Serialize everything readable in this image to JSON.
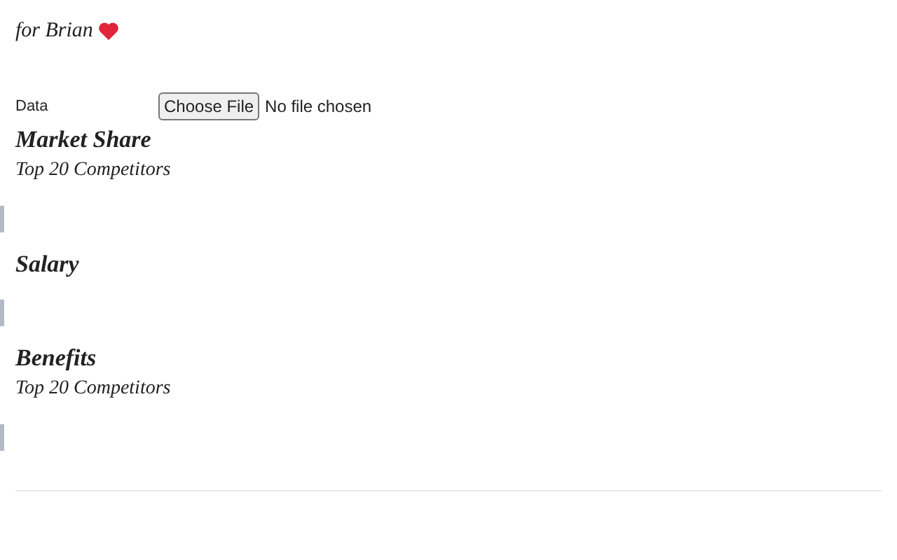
{
  "dedication": "for Brian",
  "upload": {
    "label": "Data",
    "button": "Choose File",
    "status": "No file chosen"
  },
  "sections": [
    {
      "title": "Market Share",
      "subtitle": "Top 20 Competitors"
    },
    {
      "title": "Salary"
    },
    {
      "title": "Benefits",
      "subtitle": "Top 20 Competitors"
    }
  ]
}
